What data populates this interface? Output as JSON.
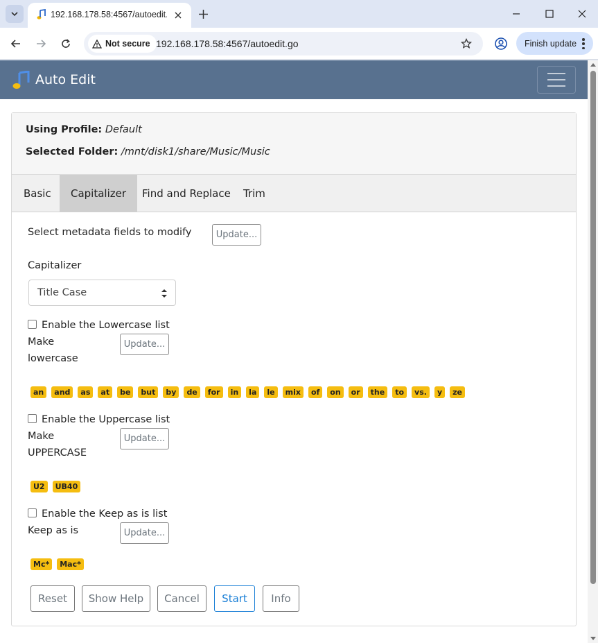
{
  "browser": {
    "tab_title": "192.168.178.58:4567/autoedit.g",
    "security_label": "Not secure",
    "url": "192.168.178.58:4567/autoedit.go",
    "finish_update_label": "Finish update"
  },
  "app": {
    "brand": "Auto Edit"
  },
  "profile": {
    "using_label": "Using Profile:",
    "using_value": "Default",
    "folder_label": "Selected Folder:",
    "folder_value": "/mnt/disk1/share/Music/Music"
  },
  "tabs": [
    {
      "label": "Basic",
      "active": false
    },
    {
      "label": "Capitalizer",
      "active": true
    },
    {
      "label": "Find and Replace",
      "active": false
    },
    {
      "label": "Trim",
      "active": false
    }
  ],
  "capitalizer": {
    "metadata_label": "Select metadata fields to modify",
    "update_label": "Update...",
    "capitalizer_label": "Capitalizer",
    "capitalizer_value": "Title Case",
    "lowercase": {
      "enable_label": "Enable the Lowercase list",
      "make_label_1": "Make",
      "make_label_2": "lowercase",
      "words": [
        "an",
        "and",
        "as",
        "at",
        "be",
        "but",
        "by",
        "de",
        "for",
        "in",
        "la",
        "le",
        "mix",
        "of",
        "on",
        "or",
        "the",
        "to",
        "vs.",
        "y",
        "ze"
      ]
    },
    "uppercase": {
      "enable_label": "Enable the Uppercase list",
      "make_label_1": "Make",
      "make_label_2": "UPPERCASE",
      "words": [
        "U2",
        "UB40"
      ]
    },
    "keep": {
      "enable_label": "Enable the Keep as is list",
      "make_label": "Keep as is",
      "words": [
        "Mc*",
        "Mac*"
      ]
    }
  },
  "footer": {
    "reset": "Reset",
    "show_help": "Show Help",
    "cancel": "Cancel",
    "start": "Start",
    "info": "Info"
  },
  "colors": {
    "navbar": "#58718f",
    "badge": "#f5bd10",
    "primary": "#1a7fd6"
  }
}
